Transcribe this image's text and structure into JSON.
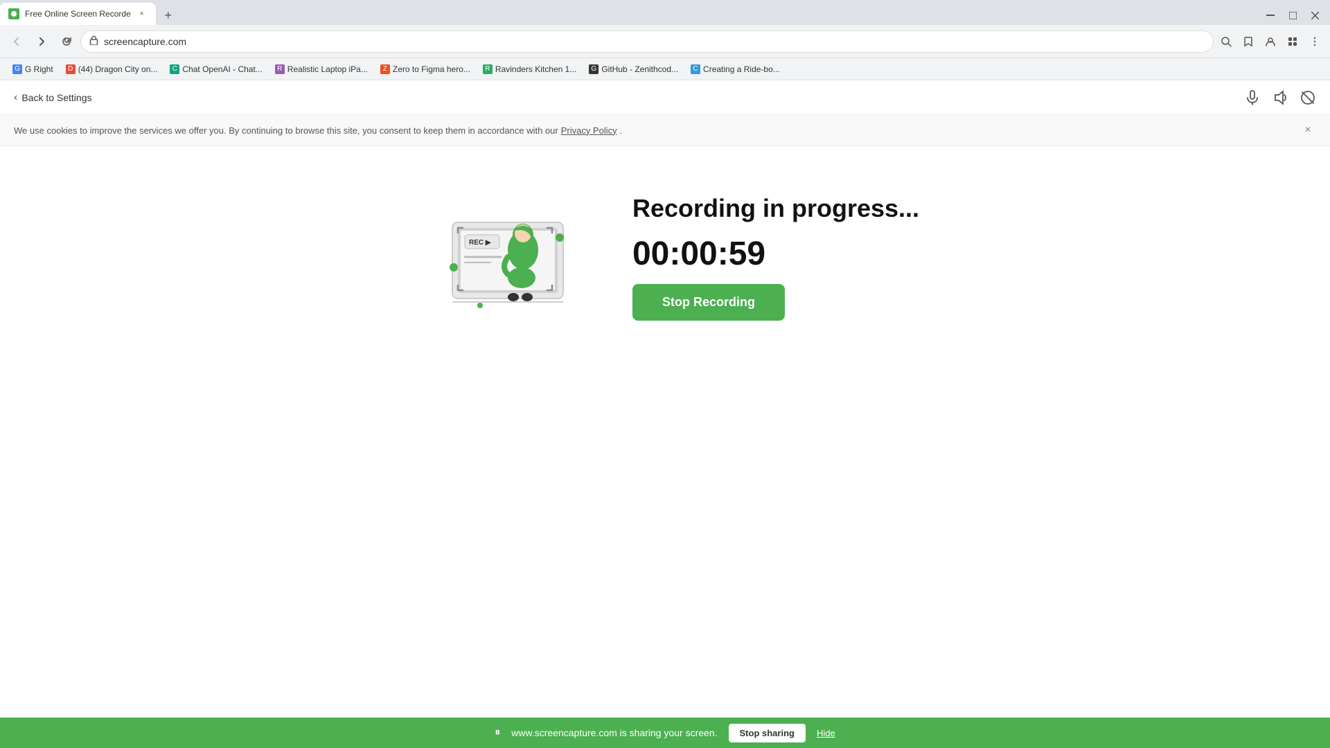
{
  "browser": {
    "tab": {
      "favicon_alt": "tab-favicon",
      "title": "Free Online Screen Recorde",
      "close_icon": "×"
    },
    "new_tab_icon": "+",
    "window_controls": {
      "minimize": "─",
      "maximize": "□",
      "close": "×"
    },
    "nav": {
      "back_icon": "←",
      "forward_icon": "→",
      "reload_icon": "↻"
    },
    "address": "screencapture.com",
    "bookmarks": [
      {
        "label": "G Right",
        "icon": "G"
      },
      {
        "label": "(44) Dragon City on...",
        "icon": "D"
      },
      {
        "label": "Chat OpenAI - Chat...",
        "icon": "C"
      },
      {
        "label": "Realistic Laptop iPa...",
        "icon": "R"
      },
      {
        "label": "Zero to Figma hero...",
        "icon": "Z"
      },
      {
        "label": "Ravinders Kitchen 1...",
        "icon": "R"
      },
      {
        "label": "GitHub - Zenithcod...",
        "icon": "G"
      },
      {
        "label": "Creating a Ride-bo...",
        "icon": "C"
      }
    ]
  },
  "page": {
    "back_link": "Back to Settings",
    "topbar_icons": {
      "mic": "🎤",
      "speaker": "🔊",
      "no_cam": "🚫"
    },
    "cookie_banner": {
      "text": "We use cookies to improve the services we offer you. By continuing to browse this site, you consent to keep them in accordance with our",
      "link_text": "Privacy Policy",
      "close_icon": "×"
    },
    "recording": {
      "status": "Recording in progress...",
      "timer": "00:00:59",
      "stop_button": "Stop Recording"
    },
    "share_bar": {
      "icon": "⏸",
      "text": "www.screencapture.com is sharing your screen.",
      "stop_button": "Stop sharing",
      "hide_button": "Hide"
    }
  }
}
